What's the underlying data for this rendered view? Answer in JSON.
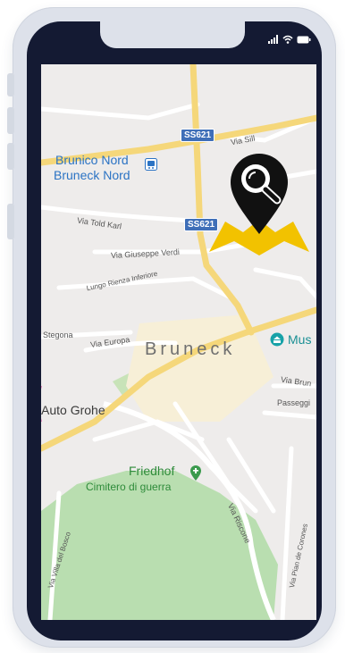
{
  "status_bar": {
    "signal_icon": "signal-icon",
    "wifi_icon": "wifi-icon",
    "battery_icon": "battery-icon"
  },
  "map": {
    "town": "Bruneck",
    "station_line1": "Brunico Nord",
    "station_line2": "Bruneck Nord",
    "road_shield_1": "SS621",
    "road_shield_2": "SS621",
    "street_via_sill": "Via Sill",
    "street_via_told_karl": "Via Told Karl",
    "street_via_giuseppe_verdi": "Via Giuseppe Verdi",
    "street_lungo_rienza": "Lungo Rienza Inferiore",
    "street_stegona": "Stegona",
    "street_via_europa": "Via Europa",
    "street_via_brun": "Via Brun",
    "street_passeggi": "Passeggi",
    "poi_auto_grohe": "Auto Grohe",
    "poi_museum": "Mus",
    "cemetery_line1": "Friedhof",
    "cemetery_line2": "Cimitero di guerra",
    "street_via_riscone": "Via Riscone",
    "street_via_villa_del_bosco": "Via Villa del Bosco",
    "street_via_pian_de_corones": "Via Pian de Corones"
  },
  "colors": {
    "pin_black": "#111111",
    "map_yellow": "#f2c200",
    "road_yellow": "#f5d77a",
    "park_green": "#b9deb0"
  }
}
